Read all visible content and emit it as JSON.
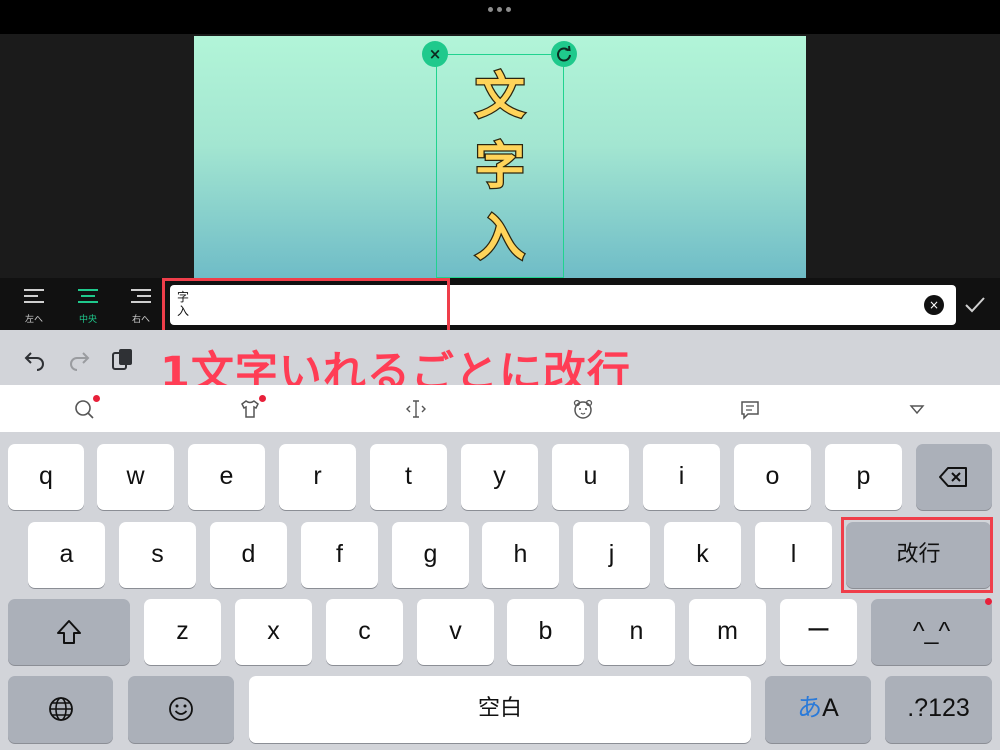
{
  "canvas": {
    "chars": [
      "文",
      "字",
      "入"
    ],
    "close_glyph": "×",
    "rotate_glyph": "⟳"
  },
  "toolbar": {
    "align_left": "左へ",
    "align_center": "中央",
    "align_right": "右へ",
    "input_value": "字\n入",
    "clear_glyph": "×"
  },
  "annotation": "1文字いれるごとに改行",
  "colors": {
    "accent": "#1fc98c",
    "highlight": "#ef3e4a",
    "annotation": "#ff3d55"
  },
  "keyboard": {
    "row1": [
      "q",
      "w",
      "e",
      "r",
      "t",
      "y",
      "u",
      "i",
      "o",
      "p"
    ],
    "row2": [
      "a",
      "s",
      "d",
      "f",
      "g",
      "h",
      "j",
      "k",
      "l"
    ],
    "row3": [
      "z",
      "x",
      "c",
      "v",
      "b",
      "n",
      "m",
      "ー"
    ],
    "return_label": "改行",
    "kaomoji_label": "^_^",
    "space_label": "空白",
    "kana_label_a": "あ",
    "kana_label_b": "A",
    "numbers_label": ".?123"
  },
  "icons": [
    "undo-icon",
    "redo-icon",
    "paste-icon",
    "search-icon",
    "shirt-icon",
    "cursor-icon",
    "emoji-face-icon",
    "memo-icon",
    "collapse-icon",
    "backspace-icon",
    "shift-icon",
    "globe-icon",
    "emoji-icon"
  ]
}
